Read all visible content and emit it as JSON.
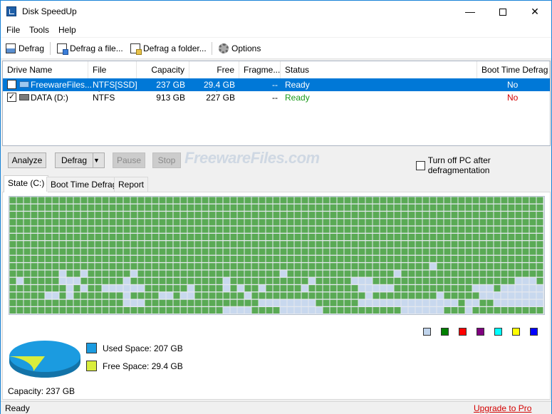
{
  "window": {
    "title": "Disk SpeedUp"
  },
  "menu": [
    "File",
    "Tools",
    "Help"
  ],
  "toolbar": {
    "defrag": "Defrag",
    "defrag_file": "Defrag a file...",
    "defrag_folder": "Defrag a folder...",
    "options": "Options"
  },
  "drives": {
    "columns": [
      "Drive Name",
      "File System",
      "Capacity",
      "Free Space",
      "Fragme...",
      "Status",
      "Boot Time Defrag"
    ],
    "rows": [
      {
        "checked": false,
        "icon": "ssd-drive-icon",
        "name": "FreewareFiles...",
        "fs": "NTFS[SSD]",
        "capacity": "237 GB",
        "free": "29.4 GB",
        "frag": "--",
        "status": "Ready",
        "boot": "No"
      },
      {
        "checked": true,
        "icon": "hdd-drive-icon",
        "name": "DATA (D:)",
        "fs": "NTFS",
        "capacity": "913 GB",
        "free": "227 GB",
        "frag": "--",
        "status": "Ready",
        "boot": "No"
      }
    ]
  },
  "controls": {
    "analyze": "Analyze",
    "defrag": "Defrag",
    "pause": "Pause",
    "stop": "Stop",
    "shutdown_label": "Turn off PC after defragmentation"
  },
  "watermark": "FreewareFiles.com",
  "tabs": [
    "State (C:)",
    "Boot Time Defrag",
    "Report"
  ],
  "legend_colors": [
    "#c0d4ec",
    "#008000",
    "#ff0000",
    "#800080",
    "#00ffff",
    "#ffff00",
    "#0000ff"
  ],
  "disk": {
    "used_label": "Used Space: 207 GB",
    "free_label": "Free Space: 29.4 GB",
    "capacity_label": "Capacity: 237 GB",
    "used_color": "#1b9be0",
    "free_color": "#d9ed3c"
  },
  "statusbar": {
    "text": "Ready",
    "upgrade": "Upgrade to Pro"
  }
}
